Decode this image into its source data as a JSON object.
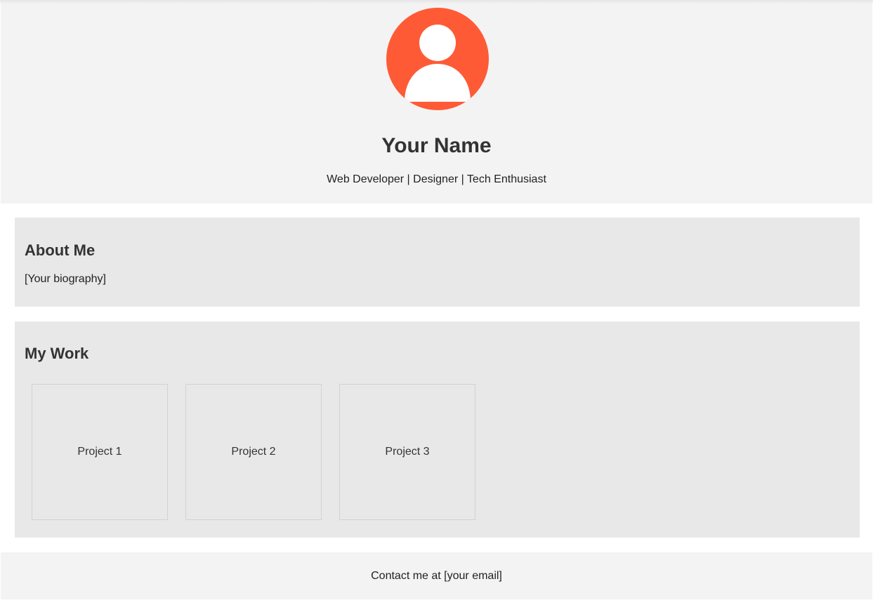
{
  "header": {
    "avatar_icon": "user-avatar-icon",
    "avatar_color": "#ff5a36",
    "name": "Your Name",
    "tagline": "Web Developer | Designer | Tech Enthusiast"
  },
  "about": {
    "heading": "About Me",
    "bio": "[Your biography]"
  },
  "work": {
    "heading": "My Work",
    "projects": [
      {
        "label": "Project 1"
      },
      {
        "label": "Project 2"
      },
      {
        "label": "Project 3"
      }
    ]
  },
  "footer": {
    "contact": "Contact me at [your email]"
  },
  "colors": {
    "header_bg": "#f3f3f3",
    "card_bg": "#e8e8e8",
    "text": "#333333"
  }
}
